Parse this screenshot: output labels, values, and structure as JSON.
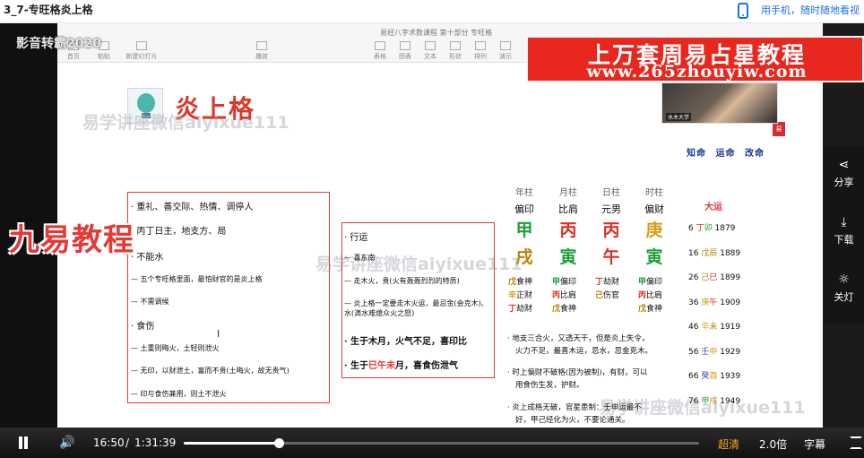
{
  "header": {
    "video_title": "3_7-专旺格炎上格",
    "phone_link": "用手机，随时随地看视",
    "phone_icon": "phone-icon"
  },
  "player": {
    "top_watermark": "影音转霸2020",
    "ppt_title": "易经八字术数课程 第十部分 专旺格",
    "ppt_buttons": [
      "首页",
      "粘贴",
      "新建幻灯片",
      "播放",
      "表格",
      "图表",
      "文本",
      "形状",
      "排列",
      "演示"
    ],
    "promo_line1": "上万套周易占星教程",
    "promo_line2": "www.265zhouyiw.com",
    "cam_label": "水木大学"
  },
  "slide": {
    "title": "炎上格",
    "watermarks": [
      "易学讲座微信aiyixue111",
      "易学讲座微信aiyixue111",
      "易学讲座微信aiyixue111"
    ],
    "brand_overlay": "九易教程",
    "motto": "知命 运命 改命",
    "seal": "易",
    "box1": [
      "· 重礼、善交际、热情、调停人",
      "· 丙丁日主，地支方、局",
      "· 不能水",
      "— 五个专旺格里面，最怕财官的是炎上格",
      "— 不需调候",
      "· 食伤",
      "— 土重则晦火，土轻则泄火",
      "— 无印，以财泄土，富而不贵(土晦火，故无贵气)",
      "— 印与食伤兼用，则土不泄火"
    ],
    "box2": [
      "· 行运",
      "— 喜东南",
      "— 走木火，贵(火有轰轰烈烈的特质)",
      "— 炎上格一定要走木火运，最忌金(会克木)、水(滴水难熄众火之怒)"
    ],
    "box2_bold1_pre": "· 生于木月，火气不足，喜印比",
    "box2_bold2_pre": "· 生于",
    "box2_bold2_red": "巳午未",
    "box2_bold2_post": "月，喜食伤泄气",
    "cursor": "I",
    "bazi": {
      "headers": [
        "年柱",
        "月柱",
        "日柱",
        "时柱"
      ],
      "ten_gods": [
        "偏印",
        "比肩",
        "元男",
        "偏财"
      ],
      "stems": [
        {
          "char": "甲",
          "color": "#1e9e3a"
        },
        {
          "char": "丙",
          "color": "#d93025"
        },
        {
          "char": "丙",
          "color": "#d93025"
        },
        {
          "char": "庚",
          "color": "#d4a017"
        }
      ],
      "branches": [
        {
          "char": "戌",
          "color": "#b8860b"
        },
        {
          "char": "寅",
          "color": "#1e9e3a"
        },
        {
          "char": "午",
          "color": "#d93025"
        },
        {
          "char": "寅",
          "color": "#1e9e3a"
        }
      ],
      "hidden": [
        [
          {
            "c": "戊",
            "color": "#b8860b",
            "g": "食神"
          },
          {
            "c": "辛",
            "color": "#d4a017",
            "g": "正财"
          },
          {
            "c": "丁",
            "color": "#d93025",
            "g": "劫财"
          }
        ],
        [
          {
            "c": "甲",
            "color": "#1e9e3a",
            "g": "偏印"
          },
          {
            "c": "丙",
            "color": "#d93025",
            "g": "比肩"
          },
          {
            "c": "戊",
            "color": "#b8860b",
            "g": "食神"
          }
        ],
        [
          {
            "c": "丁",
            "color": "#d93025",
            "g": "劫财"
          },
          {
            "c": "己",
            "color": "#b8860b",
            "g": "伤官"
          }
        ],
        [
          {
            "c": "甲",
            "color": "#1e9e3a",
            "g": "偏印"
          },
          {
            "c": "丙",
            "color": "#d93025",
            "g": "比肩"
          },
          {
            "c": "戊",
            "color": "#b8860b",
            "g": "食神"
          }
        ]
      ]
    },
    "dayun": {
      "title": "大运",
      "rows": [
        {
          "age": "6",
          "gz": "丁卯",
          "year": "1879",
          "c1": "#d93025",
          "c2": "#1e9e3a"
        },
        {
          "age": "16",
          "gz": "戊辰",
          "year": "1889",
          "c1": "#b8860b",
          "c2": "#b8860b"
        },
        {
          "age": "26",
          "gz": "己巳",
          "year": "1899",
          "c1": "#b8860b",
          "c2": "#d93025"
        },
        {
          "age": "36",
          "gz": "庚午",
          "year": "1909",
          "c1": "#d4a017",
          "c2": "#d93025"
        },
        {
          "age": "46",
          "gz": "辛未",
          "year": "1919",
          "c1": "#d4a017",
          "c2": "#b8860b"
        },
        {
          "age": "56",
          "gz": "壬申",
          "year": "1929",
          "c1": "#1f4e9e",
          "c2": "#d4a017"
        },
        {
          "age": "66",
          "gz": "癸酉",
          "year": "1939",
          "c1": "#1f4e9e",
          "c2": "#d4a017"
        },
        {
          "age": "76",
          "gz": "甲戌",
          "year": "1949",
          "c1": "#1e9e3a",
          "c2": "#b8860b"
        }
      ]
    },
    "notes": [
      "· 地支三合火，又透天干，但是炎上失令，",
      "火力不足，最喜木运，忌水，忌金克木。",
      "· 时上偏财不破格(因为被制)，有财，可以",
      "用食伤生发，护财。",
      "· 炎上成格无破，官星患制：壬申运最不",
      "好，甲己经化为火，不要论通关。"
    ]
  },
  "sidebar": [
    {
      "icon": "share-icon",
      "glyph": "⋖",
      "label": "分享"
    },
    {
      "icon": "download-icon",
      "glyph": "⤓",
      "label": "下载"
    },
    {
      "icon": "light-off-icon",
      "glyph": "☼",
      "label": "关灯"
    }
  ],
  "controls": {
    "current_time": "16:50",
    "separator": "/",
    "duration": "1:31:39",
    "progress_fraction": 0.184,
    "quality": "超清",
    "speed": "2.0倍",
    "subtitle": "字幕"
  }
}
